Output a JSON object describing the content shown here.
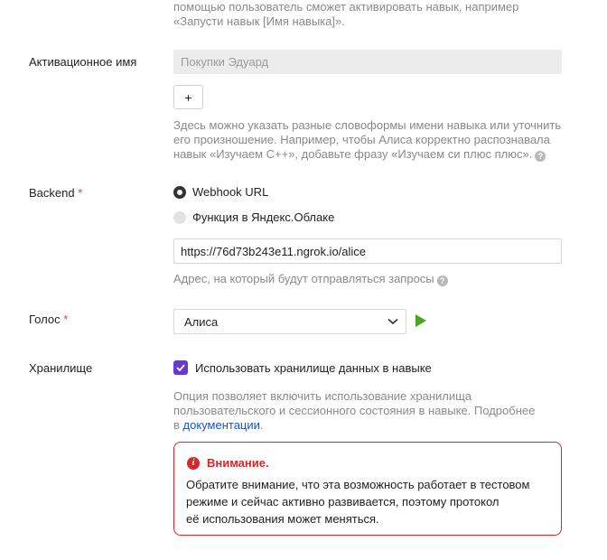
{
  "top_hint": {
    "line1": "помощью пользователь сможет активировать навык, например",
    "line2": "«Запусти навык [Имя навыка]»."
  },
  "activation": {
    "label": "Активационное имя",
    "placeholder": "Покупки Эдуард",
    "add_button": "+",
    "hint_line1": "Здесь можно указать разные словоформы имени навыка или уточнить",
    "hint_line2": "его произношение. Например, чтобы Алиса корректно распознавала",
    "hint_line3": "навык «Изучаем С++», добавьте фразу «Изучаем си плюс плюс».",
    "help_icon": "?"
  },
  "backend": {
    "label": "Backend",
    "required": "*",
    "options": [
      {
        "label": "Webhook URL",
        "selected": true
      },
      {
        "label": "Функция в Яндекс.Облаке",
        "selected": false
      }
    ],
    "url_value": "https://76d73b243e11.ngrok.io/alice",
    "hint": "Адрес, на который будут отправляться запросы",
    "help_icon": "?"
  },
  "voice": {
    "label": "Голос",
    "required": "*",
    "selected": "Алиса",
    "play_icon": "play-icon"
  },
  "storage": {
    "label": "Хранилище",
    "checkbox_label": "Использовать хранилище данных в навыке",
    "checked": true,
    "hint_line1": "Опция позволяет включить использование хранилища",
    "hint_line2": "пользовательского и сессионного состояния в навыке. Подробнее",
    "hint_line3_prefix": "в ",
    "hint_link": "документации",
    "hint_line3_suffix": "."
  },
  "warning": {
    "icon": "i",
    "title": "Внимание.",
    "line1": "Обратите внимание, что эта возможность работает в тестовом",
    "line2": "режиме и сейчас активно развивается, поэтому протокол",
    "line3": "её использования может меняться."
  },
  "colors": {
    "accent": "#6839cf",
    "warning": "#d9262a",
    "play": "#45a81e",
    "link": "#1a55c5"
  }
}
